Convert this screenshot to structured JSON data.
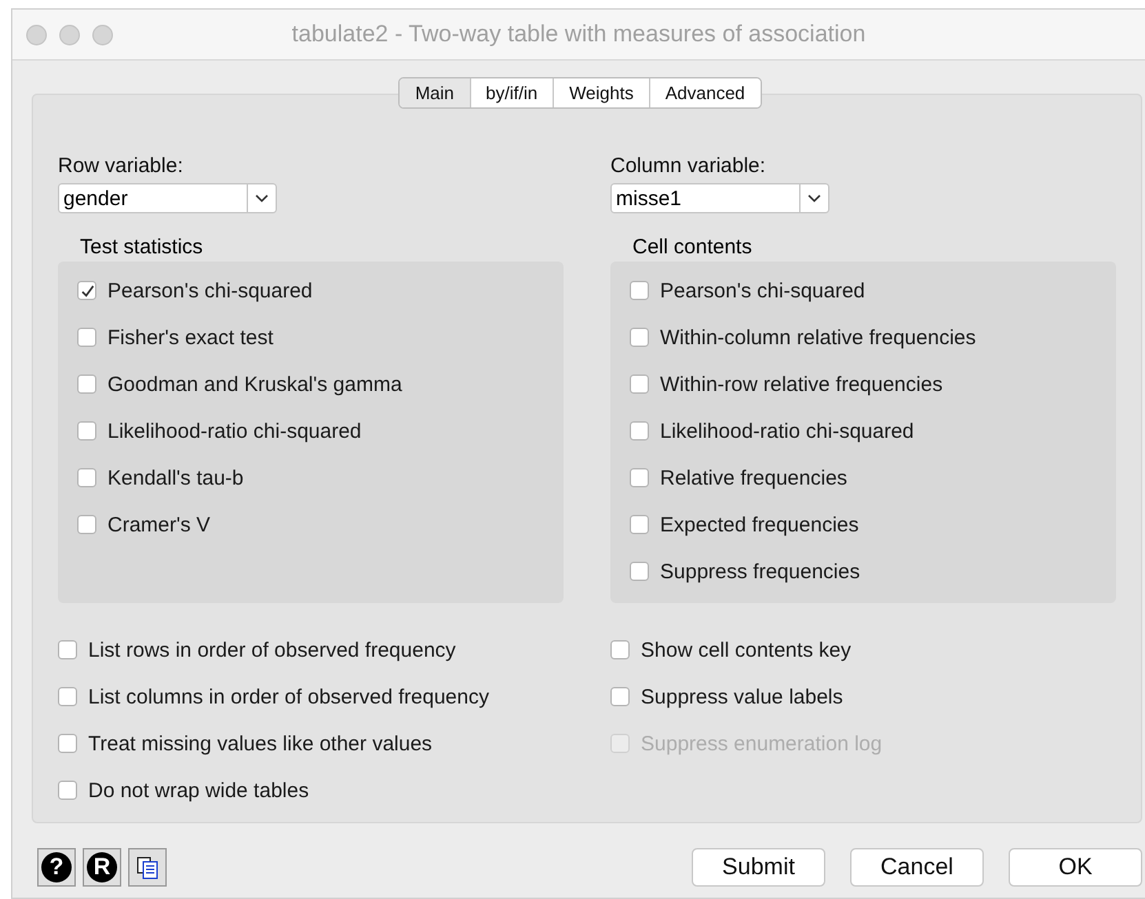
{
  "window": {
    "title": "tabulate2 - Two-way table with measures of association"
  },
  "tabs": [
    {
      "label": "Main",
      "selected": true
    },
    {
      "label": "by/if/in",
      "selected": false
    },
    {
      "label": "Weights",
      "selected": false
    },
    {
      "label": "Advanced",
      "selected": false
    }
  ],
  "row_variable": {
    "label": "Row variable:",
    "value": "gender"
  },
  "column_variable": {
    "label": "Column variable:",
    "value": "misse1"
  },
  "test_statistics": {
    "title": "Test statistics",
    "items": [
      {
        "label": "Pearson's chi-squared",
        "checked": true
      },
      {
        "label": "Fisher's exact test",
        "checked": false
      },
      {
        "label": "Goodman and Kruskal's gamma",
        "checked": false
      },
      {
        "label": "Likelihood-ratio chi-squared",
        "checked": false
      },
      {
        "label": "Kendall's tau-b",
        "checked": false
      },
      {
        "label": "Cramer's V",
        "checked": false
      }
    ]
  },
  "cell_contents": {
    "title": "Cell contents",
    "items": [
      {
        "label": "Pearson's chi-squared",
        "checked": false
      },
      {
        "label": "Within-column relative frequencies",
        "checked": false
      },
      {
        "label": "Within-row relative frequencies",
        "checked": false
      },
      {
        "label": "Likelihood-ratio chi-squared",
        "checked": false
      },
      {
        "label": "Relative frequencies",
        "checked": false
      },
      {
        "label": "Expected frequencies",
        "checked": false
      },
      {
        "label": "Suppress frequencies",
        "checked": false
      }
    ]
  },
  "left_options": [
    {
      "label": "List rows in order of observed frequency",
      "checked": false,
      "disabled": false
    },
    {
      "label": "List columns in order of observed frequency",
      "checked": false,
      "disabled": false
    },
    {
      "label": "Treat missing values like other values",
      "checked": false,
      "disabled": false
    },
    {
      "label": "Do not wrap wide tables",
      "checked": false,
      "disabled": false
    }
  ],
  "right_options": [
    {
      "label": "Show cell contents key",
      "checked": false,
      "disabled": false
    },
    {
      "label": "Suppress value labels",
      "checked": false,
      "disabled": false
    },
    {
      "label": "Suppress enumeration log",
      "checked": false,
      "disabled": true
    }
  ],
  "tool_icons": [
    {
      "kind": "glyph",
      "glyph": "?"
    },
    {
      "kind": "glyph",
      "glyph": "R"
    },
    {
      "kind": "copy"
    }
  ],
  "buttons": [
    "Submit",
    "Cancel",
    "OK"
  ]
}
